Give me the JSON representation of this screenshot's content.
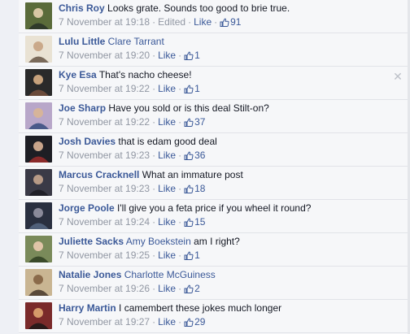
{
  "comments": [
    {
      "author": "Chris Roy",
      "tag": "",
      "text": "Looks grate. Sounds too good to brie true.",
      "time": "7 November at 19:18",
      "edited": "Edited",
      "like_label": "Like",
      "likes": "91",
      "avatar_colors": [
        "#5a6b3a",
        "#d8c7a4",
        "#2f3a2a"
      ]
    },
    {
      "author": "Lulu Little",
      "tag": "Clare Tarrant",
      "text": "",
      "time": "7 November at 19:20",
      "edited": "",
      "like_label": "Like",
      "likes": "1",
      "avatar_colors": [
        "#e9e2d3",
        "#caa98a",
        "#7a6a5a"
      ]
    },
    {
      "author": "Kye Esa",
      "tag": "",
      "text": "That's nacho cheese!",
      "time": "7 November at 19:22",
      "edited": "",
      "like_label": "Like",
      "likes": "1",
      "avatar_colors": [
        "#2a2a2a",
        "#c7a27c",
        "#6a4a3a"
      ]
    },
    {
      "author": "Joe Sharp",
      "tag": "",
      "text": "Have you sold or is this deal Stilt-on?",
      "time": "7 November at 19:22",
      "edited": "",
      "like_label": "Like",
      "likes": "37",
      "avatar_colors": [
        "#b8a7c9",
        "#d6b49a",
        "#4a5a8a"
      ]
    },
    {
      "author": "Josh Davies",
      "tag": "",
      "text": "that is edam good deal",
      "time": "7 November at 19:23",
      "edited": "",
      "like_label": "Like",
      "likes": "36",
      "avatar_colors": [
        "#1e1e24",
        "#c8a48a",
        "#8a2a2a"
      ]
    },
    {
      "author": "Marcus Cracknell",
      "tag": "",
      "text": "What an immature post",
      "time": "7 November at 19:23",
      "edited": "",
      "like_label": "Like",
      "likes": "18",
      "avatar_colors": [
        "#3a3a46",
        "#b79a86",
        "#202028"
      ]
    },
    {
      "author": "Jorge Poole",
      "tag": "",
      "text": "I'll give you a feta price if you wheel it round?",
      "time": "7 November at 19:24",
      "edited": "",
      "like_label": "Like",
      "likes": "15",
      "avatar_colors": [
        "#2a3040",
        "#8a8a9a",
        "#50607a"
      ]
    },
    {
      "author": "Juliette Sacks",
      "tag": "Amy Boekstein",
      "text": "am I right?",
      "time": "7 November at 19:25",
      "edited": "",
      "like_label": "Like",
      "likes": "1",
      "avatar_colors": [
        "#7a8a5a",
        "#e0c4a8",
        "#3a4a2a"
      ]
    },
    {
      "author": "Natalie Jones",
      "tag": "Charlotte McGuiness",
      "text": "",
      "time": "7 November at 19:26",
      "edited": "",
      "like_label": "Like",
      "likes": "2",
      "avatar_colors": [
        "#c9b592",
        "#8a6a4a",
        "#5a4a3a"
      ]
    },
    {
      "author": "Harry Martin",
      "tag": "",
      "text": "I camembert these jokes much longer",
      "time": "7 November at 19:27",
      "edited": "",
      "like_label": "Like",
      "likes": "29",
      "avatar_colors": [
        "#7a2a2a",
        "#d69a6a",
        "#2a1a1a"
      ]
    }
  ],
  "close_icon": "close-icon",
  "thumb_icon": "thumbs-up-icon",
  "accent": "#3b5998",
  "meta_color": "#9197a3"
}
